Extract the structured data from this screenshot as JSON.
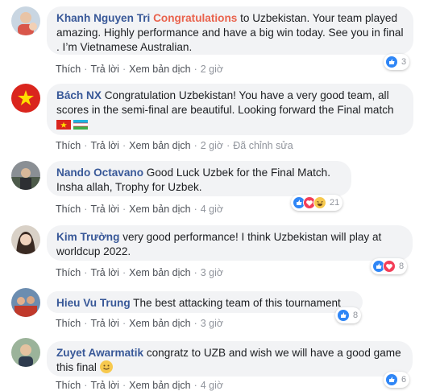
{
  "actions": {
    "like": "Thích",
    "reply": "Trả lời",
    "translate": "Xem bản dịch",
    "edited": "Đã chỉnh sửa"
  },
  "comments": [
    {
      "author": "Khanh Nguyen Tri",
      "mention": "Congratulations",
      "text": " to Uzbekistan. Your team played amazing. Highly performance and have a big win today. See you in final . I’m Vietnamese Australian.",
      "time": "2 giờ",
      "reactions": [
        "like"
      ],
      "reaction_count": "3"
    },
    {
      "author": "Bách NX",
      "text": "Congratulation Uzbekistan! You have a very good team, all scores in the semi-final are beautiful. Looking forward the Final match",
      "flags": [
        "vietnam-flag",
        "uzbekistan-flag"
      ],
      "time": "2 giờ",
      "edited": true
    },
    {
      "author": "Nando Octavano",
      "text": "Good Luck Uzbek for the Final Match. Insha allah, Trophy for Uzbek.",
      "time": "4 giờ",
      "reactions": [
        "like",
        "love",
        "haha"
      ],
      "reaction_count": "21"
    },
    {
      "author": "Kim Trường",
      "text": "very good performance! I think Uzbekistan will play at worldcup 2022.",
      "time": "3 giờ",
      "reactions": [
        "like",
        "love"
      ],
      "reaction_count": "8"
    },
    {
      "author": "Hieu Vu Trung",
      "text": "The best attacking team of this tournament",
      "time": "3 giờ",
      "reactions": [
        "like"
      ],
      "reaction_count": "8"
    },
    {
      "author": "Zuyet Awarmatik",
      "text": "congratz to UZB and wish we will have a good game this final",
      "emoji": "smile-emoji",
      "time": "4 giờ",
      "reactions": [
        "like"
      ],
      "reaction_count": "6"
    }
  ]
}
